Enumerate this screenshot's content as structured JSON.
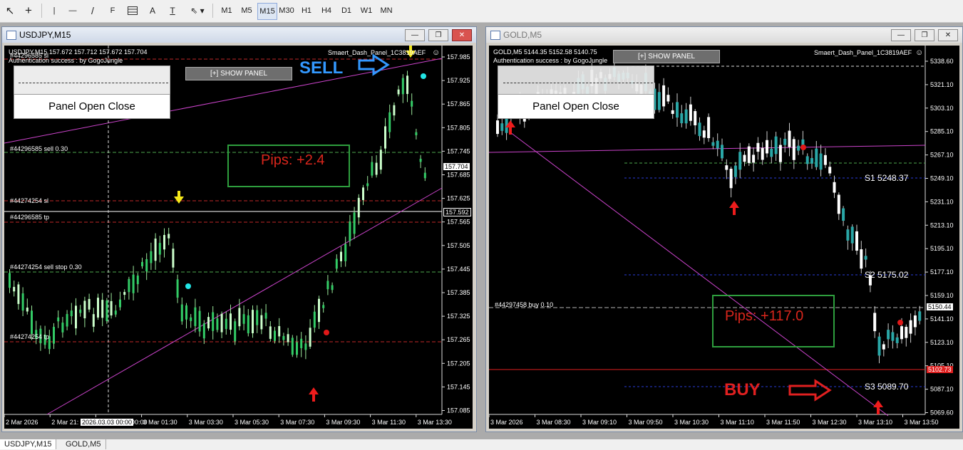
{
  "toolbar": {
    "timeframes": [
      "M1",
      "M5",
      "M15",
      "M30",
      "H1",
      "H4",
      "D1",
      "W1",
      "MN"
    ],
    "active_timeframe": "M15",
    "tool_glyphs": {
      "cursor": "↖",
      "crosshair": "+",
      "vline": "|",
      "hline": "—",
      "trendline": "/",
      "fib": "F",
      "text": "A",
      "label": "T"
    }
  },
  "window_left": {
    "title": "USDJPY,M15",
    "header": "USDJPY,M15  157.672 157.712 157.672 157.704",
    "auth": "Authentication success : by GogoJungle",
    "ea_name": "Smaert_Dash_Panel_1C3819AEF",
    "show_panel": "[+] SHOW PANEL",
    "panel_btn": "Panel Open Close",
    "sell_label": "SELL",
    "pips": "Pips: +2.4",
    "order_labels": [
      "#44296585 sl",
      "#44296585 sell 0.30",
      "#44274254 sl",
      "#44296585 tp",
      "#44274254 sell stop 0.30",
      "#44274254 tp"
    ],
    "price_axis": [
      "157.985",
      "157.925",
      "157.865",
      "157.805",
      "157.745",
      "157.685",
      "157.625",
      "157.565",
      "157.505",
      "157.445",
      "157.385",
      "157.325",
      "157.265",
      "157.205",
      "157.145",
      "157.085"
    ],
    "bid_price": "157.704",
    "line_price": "157.592",
    "time_axis": [
      "2 Mar 2026",
      "2 Mar 21:",
      "2026.03.03 00:00",
      "3 Mar 01:30",
      "3 Mar 03:30",
      "3 Mar 05:30",
      "3 Mar 07:30",
      "3 Mar 09:30",
      "3 Mar 11:30",
      "3 Mar 13:30"
    ]
  },
  "window_right": {
    "title": "GOLD,M5",
    "header": "GOLD,M5  5144.35 5152.58 5140.75",
    "auth": "Authentication success : by GogoJungle",
    "ea_name": "Smaert_Dash_Panel_1C3819AEF",
    "show_panel": "[+] SHOW PANEL",
    "panel_btn": "Panel Open Close",
    "buy_label": "BUY",
    "pips": "Pips: +117.0",
    "order_label": "#44297458 buy 0.10",
    "s1": "S1 5248.37",
    "s2": "S2 5175.02",
    "s3": "S3 5089.70",
    "price_axis": [
      "5338.60",
      "5321.10",
      "5303.10",
      "5285.10",
      "5267.10",
      "5249.10",
      "5231.10",
      "5213.10",
      "5195.10",
      "5177.10",
      "5159.10",
      "5141.10",
      "5123.10",
      "5105.10",
      "5087.10",
      "5069.60"
    ],
    "bid_price": "5150.44",
    "red_line_price": "5102.73",
    "time_axis": [
      "3 Mar 2026",
      "3 Mar 08:30",
      "3 Mar 09:10",
      "3 Mar 09:50",
      "3 Mar 10:30",
      "3 Mar 11:10",
      "3 Mar 11:50",
      "3 Mar 12:30",
      "3 Mar 13:10",
      "3 Mar 13:50"
    ]
  },
  "tabs": [
    "USDJPY,M15",
    "GOLD,M5"
  ],
  "colors": {
    "chart_bg": "#000000",
    "bull": "#ccffcc",
    "bear": "#33cc66",
    "sl_line": "#c02828",
    "entry_line": "#4ea84e",
    "trend_line": "#cc44cc",
    "pips_text": "#d9261c",
    "pips_border": "#2e9e3e",
    "sell_text": "#3399ff",
    "buy_text": "#e02020"
  }
}
